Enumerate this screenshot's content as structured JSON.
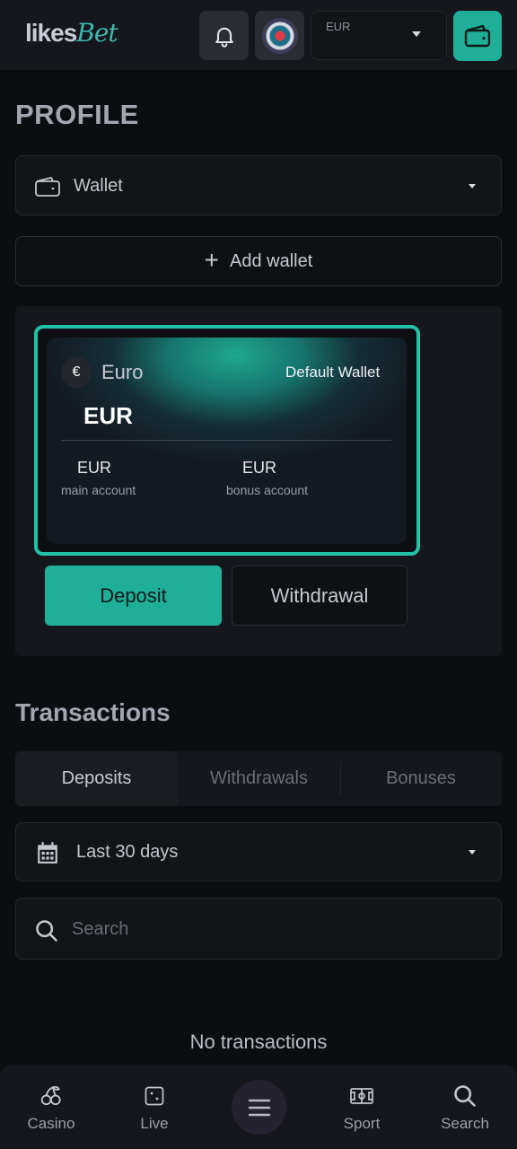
{
  "header": {
    "logo_part1": "likes",
    "logo_part2": "Bet",
    "currency": "EUR"
  },
  "page_title": "PROFILE",
  "wallet_select": {
    "label": "Wallet"
  },
  "add_wallet": {
    "label": "Add wallet"
  },
  "wallet_card": {
    "symbol": "€",
    "name": "Euro",
    "default_label": "Default Wallet",
    "currency": "EUR",
    "main_account": {
      "currency": "EUR",
      "label": "main account"
    },
    "bonus_account": {
      "currency": "EUR",
      "label": "bonus account"
    }
  },
  "actions": {
    "deposit": "Deposit",
    "withdrawal": "Withdrawal"
  },
  "transactions": {
    "title": "Transactions",
    "tabs": [
      {
        "label": "Deposits",
        "active": true
      },
      {
        "label": "Withdrawals",
        "active": false
      },
      {
        "label": "Bonuses",
        "active": false
      }
    ],
    "date_range": "Last 30 days",
    "search_placeholder": "Search",
    "empty_text": "No transactions"
  },
  "bottom_nav": [
    {
      "label": "Casino",
      "icon": "cherries-icon"
    },
    {
      "label": "Live",
      "icon": "dice-icon"
    },
    {
      "label": "",
      "icon": "menu-icon"
    },
    {
      "label": "Sport",
      "icon": "field-icon"
    },
    {
      "label": "Search",
      "icon": "search-icon"
    }
  ],
  "colors": {
    "accent": "#1fae98",
    "background": "#0c0d11",
    "panel": "#16171c"
  }
}
